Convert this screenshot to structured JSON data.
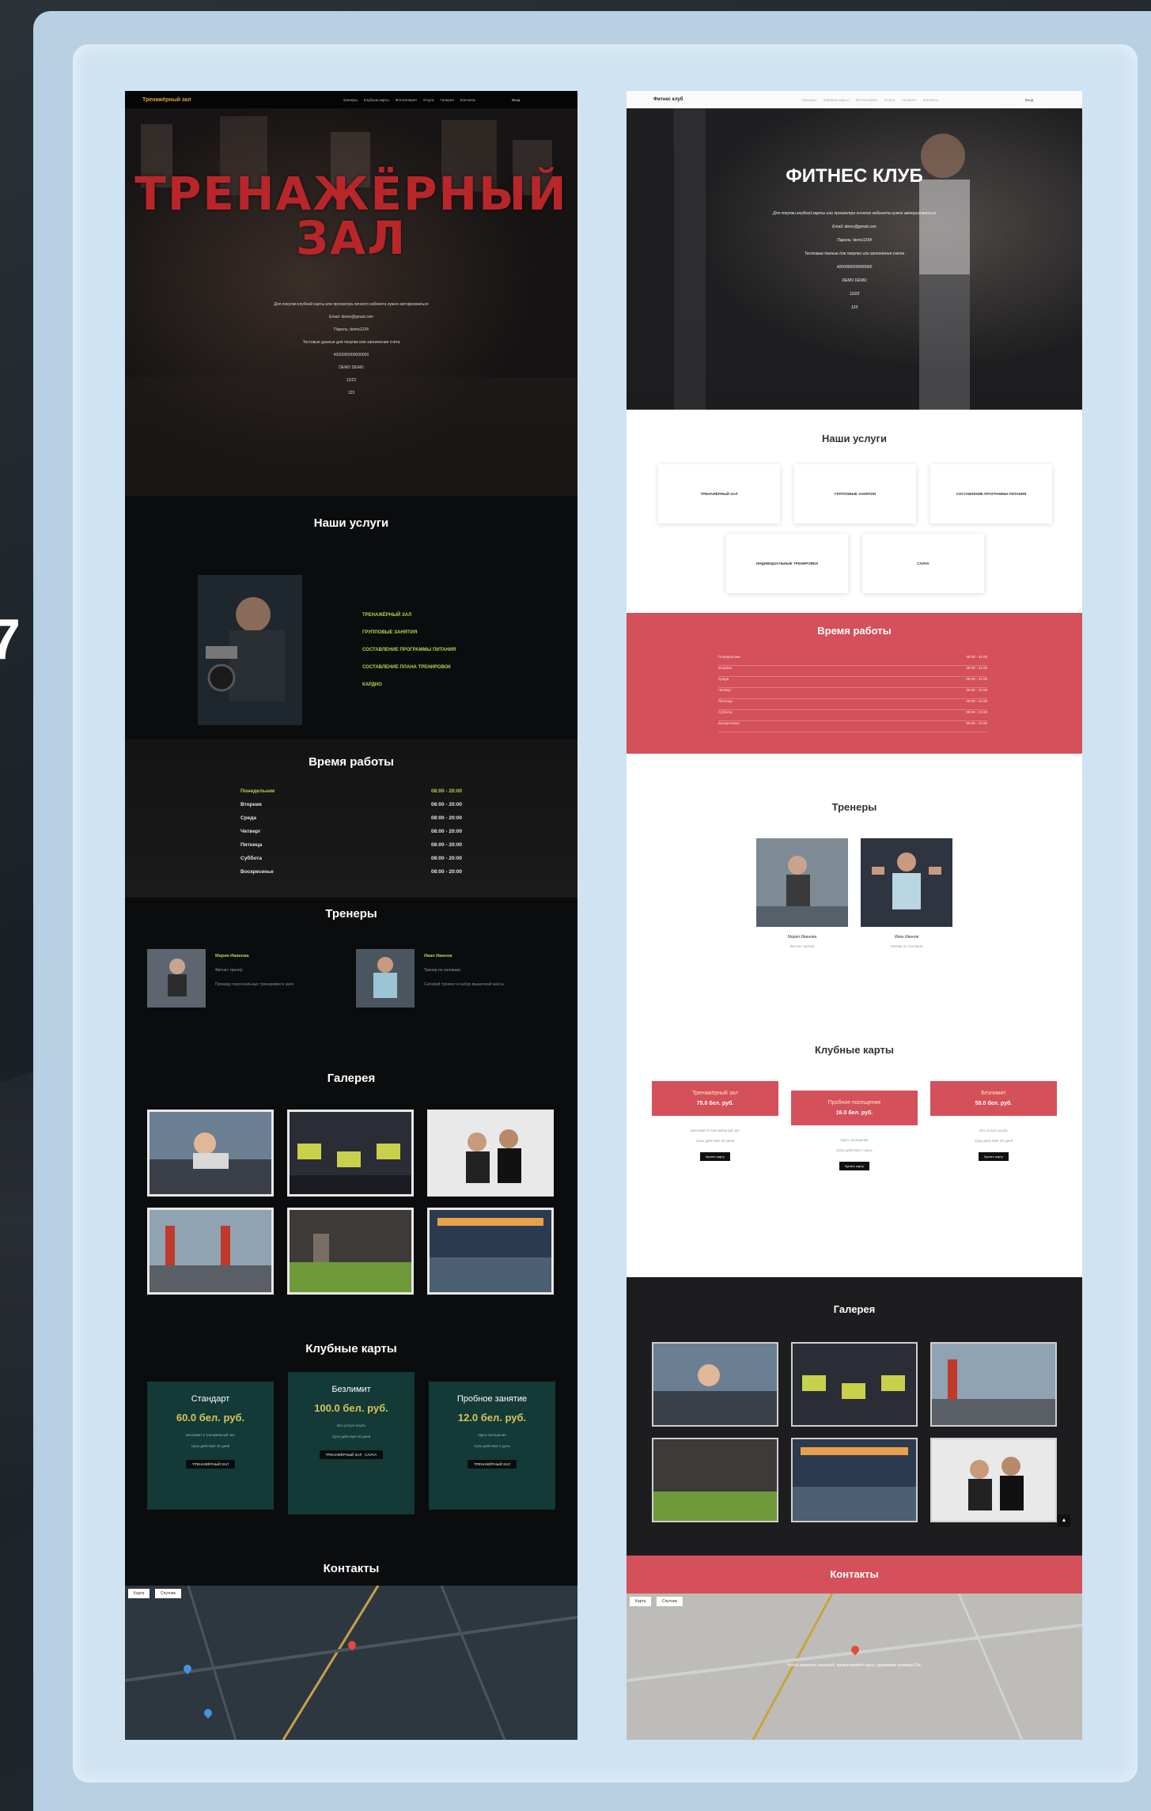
{
  "slide": {
    "number": "7"
  },
  "left_site": {
    "nav": {
      "logo": "Тренажёрный зал",
      "items": [
        "Тренеры",
        "Клубные карты",
        "Фотогалерея",
        "Услуги",
        "Галерея",
        "Контакты"
      ],
      "login": "Вход"
    },
    "hero": {
      "title_line1": "ТРЕНАЖЁРНЫЙ",
      "title_line2": "ЗАЛ",
      "lines": [
        "Для покупки клубной карты или просмотра личного кабинета нужно авторизоваться",
        "Email: demo@gmail.com",
        "Пароль: demo1234",
        "Тестовые данные для покупки или заполнения счета",
        "4200000000000000",
        "DEMO DEMO",
        "12/22",
        "123"
      ]
    },
    "services": {
      "title": "Наши услуги",
      "items": [
        "ТРЕНАЖЁРНЫЙ ЗАЛ",
        "ГРУППОВЫЕ ЗАНЯТИЯ",
        "СОСТАВЛЕНИЕ ПРОГРАММЫ ПИТАНИЯ",
        "СОСТАВЛЕНИЕ ПЛАНА ТРЕНИРОВОК",
        "КАРДИО"
      ]
    },
    "hours": {
      "title": "Время работы",
      "rows": [
        {
          "day": "Понедельник",
          "time": "08:00 - 20:00"
        },
        {
          "day": "Вторник",
          "time": "08:00 - 20:00"
        },
        {
          "day": "Среда",
          "time": "08:00 - 20:00"
        },
        {
          "day": "Четверг",
          "time": "08:00 - 20:00"
        },
        {
          "day": "Пятница",
          "time": "08:00 - 20:00"
        },
        {
          "day": "Суббота",
          "time": "08:00 - 20:00"
        },
        {
          "day": "Воскресенье",
          "time": "08:00 - 20:00"
        }
      ]
    },
    "trainers": {
      "title": "Тренеры",
      "items": [
        {
          "name": "Мария Иванова",
          "role": "Фитнес тренер",
          "desc": "Проведу персональные тренировки в зале"
        },
        {
          "name": "Иван Иванов",
          "role": "Тренер по силовым",
          "desc": "Силовой тренинг и набор мышечной массы"
        }
      ]
    },
    "gallery": {
      "title": "Галерея"
    },
    "cards": {
      "title": "Клубные карты",
      "items": [
        {
          "name": "Стандарт",
          "price": "60.0 бел. руб.",
          "desc": [
            "Безлимит в тренажёрный зал",
            "Срок действия 30 дней"
          ],
          "button": "ТРЕНАЖЁРНЫЙ ЗАЛ"
        },
        {
          "name": "Безлимит",
          "price": "100.0 бел. руб.",
          "desc": [
            "Все услуги клуба",
            "Срок действия 30 дней"
          ],
          "button": "ТРЕНАЖЁРНЫЙ ЗАЛ · САУНА"
        },
        {
          "name": "Пробное занятие",
          "price": "12.0 бел. руб.",
          "desc": [
            "Одно посещение",
            "Срок действия 1 день"
          ],
          "button": "ТРЕНАЖЁРНЫЙ ЗАЛ"
        }
      ]
    },
    "contacts": {
      "title": "Контакты",
      "map_tabs": [
        "Карта",
        "Спутник"
      ]
    }
  },
  "right_site": {
    "nav": {
      "logo": "Фитнес клуб",
      "items": [
        "Тренеры",
        "Клубные карты",
        "Фотогалерея",
        "Услуги",
        "Галерея",
        "Контакты"
      ],
      "login": "Вход"
    },
    "hero": {
      "title": "ФИТНЕС КЛУБ",
      "lines": [
        "Для покупки клубной карты или просмотра личного кабинета нужно авторизоваться",
        "Email: demo@gmail.com",
        "Пароль: demo1234",
        "Тестовые данные для покупки или заполнения счета",
        "4200000000000000",
        "DEMO DEMO",
        "12/22",
        "123"
      ]
    },
    "services": {
      "title": "Наши услуги",
      "items": [
        "ТРЕНАЖЁРНЫЙ ЗАЛ",
        "ГРУППОВЫЕ ЗАНЯТИЯ",
        "СОСТАВЛЕНИЕ ПРОГРАММЫ ПИТАНИЯ",
        "ИНДИВИДУАЛЬНЫЕ ТРЕНИРОВКИ",
        "САУНА"
      ]
    },
    "hours": {
      "title": "Время работы",
      "rows": [
        {
          "day": "Понедельник",
          "time": "08:00 - 21:00"
        },
        {
          "day": "Вторник",
          "time": "08:00 - 21:00"
        },
        {
          "day": "Среда",
          "time": "08:00 - 21:00"
        },
        {
          "day": "Четверг",
          "time": "08:00 - 21:00"
        },
        {
          "day": "Пятница",
          "time": "08:00 - 21:00"
        },
        {
          "day": "Суббота",
          "time": "08:00 - 21:00"
        },
        {
          "day": "Воскресенье",
          "time": "08:00 - 21:00"
        }
      ]
    },
    "trainers": {
      "title": "Тренеры",
      "items": [
        {
          "name": "Мария Иванова",
          "role": "Фитнес тренер"
        },
        {
          "name": "Иван Иванов",
          "role": "Тренер по силовым"
        }
      ]
    },
    "cards": {
      "title": "Клубные карты",
      "items": [
        {
          "name": "Тренажёрный зал",
          "price": "75.0 бел. руб.",
          "desc": [
            "Безлимит в тренажёрный зал",
            "Срок действия 30 дней"
          ],
          "button": "Купить карту"
        },
        {
          "name": "Пробное посещение",
          "price": "16.0 бел. руб.",
          "desc": [
            "Одно посещение",
            "Срок действия 1 день"
          ],
          "button": "Купить карту"
        },
        {
          "name": "Безлимит",
          "price": "55.0 бел. руб.",
          "desc": [
            "Все услуги клуба",
            "Срок действия 30 дней"
          ],
          "button": "Купить карту"
        }
      ]
    },
    "gallery": {
      "title": "Галерея"
    },
    "contacts": {
      "title": "Контакты",
      "map_tabs": [
        "Карта",
        "Спутник"
      ],
      "map_notice": "Чтобы изменить масштаб, прокручивайте карту, удерживая клавишу Ctrl."
    },
    "scroll_top": "▲"
  },
  "colors": {
    "left_accent": "#b7d34a",
    "left_title": "#b8262a",
    "left_card": "#133a36",
    "right_accent": "#d4505a"
  }
}
